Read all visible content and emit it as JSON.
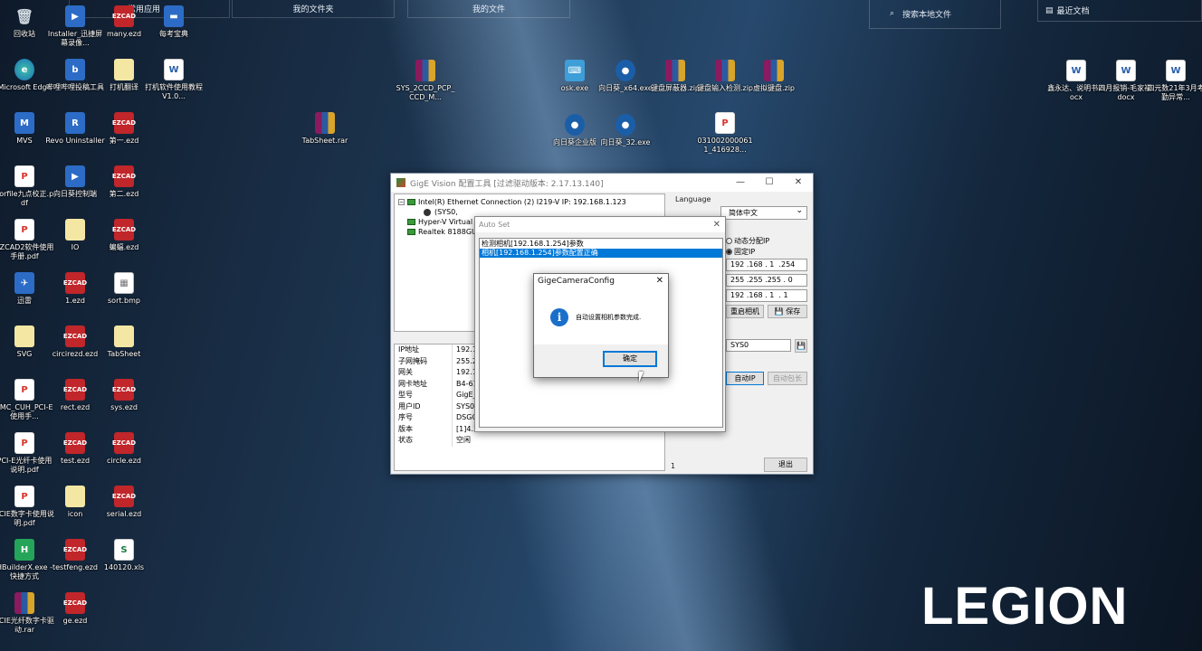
{
  "topbar": {
    "cells": [
      {
        "label": "常用应用"
      },
      {
        "label": "我的文件夹"
      },
      {
        "label": "我的文件"
      }
    ],
    "search_placeholder": "搜索本地文件",
    "recent_label": "最近文档"
  },
  "desktop": {
    "col1": [
      {
        "label": "回收站",
        "glyph": "🗑",
        "icon": "recycle-bin-icon",
        "style": "g-bin"
      },
      {
        "label": "Microsoft Edge",
        "glyph": "e",
        "icon": "edge-icon",
        "style": "g-edge"
      },
      {
        "label": "MVS",
        "glyph": "M",
        "icon": "mvs-icon",
        "style": "g-app"
      },
      {
        "label": "corfile九点校正.pdf",
        "glyph": "P",
        "icon": "pdf-icon",
        "style": "g-pdf"
      },
      {
        "label": "EZCAD2软件使用手册.pdf",
        "glyph": "P",
        "icon": "pdf-icon",
        "style": "g-pdf"
      },
      {
        "label": "迅雷",
        "glyph": "✈",
        "icon": "xunlei-icon",
        "style": "g-app"
      },
      {
        "label": "SVG",
        "glyph": "",
        "icon": "file-icon",
        "style": "g-file"
      },
      {
        "label": "LMC_CUH_PCI-E使用手...",
        "glyph": "P",
        "icon": "pdf-icon",
        "style": "g-pdf"
      },
      {
        "label": "PCI-E光纤卡使用说明.pdf",
        "glyph": "P",
        "icon": "pdf-icon",
        "style": "g-pdf"
      },
      {
        "label": "PCIE数字卡使用说明.pdf",
        "glyph": "P",
        "icon": "pdf-icon",
        "style": "g-pdf"
      },
      {
        "label": "HBuilderX.exe - 快捷方式",
        "glyph": "H",
        "icon": "hbuilder-icon",
        "style": "g-green"
      },
      {
        "label": "PCIE光纤数字卡驱动.rar",
        "glyph": "",
        "icon": "rar-icon",
        "style": "g-rar"
      }
    ],
    "col2": [
      {
        "label": "Installer_迅捷屏幕录像...",
        "glyph": "▶",
        "icon": "video-recorder-icon",
        "style": "g-app"
      },
      {
        "label": "哔哩哔哩投稿工具",
        "glyph": "b",
        "icon": "bilibili-icon",
        "style": "g-app"
      },
      {
        "label": "Revo Uninstaller",
        "glyph": "R",
        "icon": "uninstaller-icon",
        "style": "g-app"
      },
      {
        "label": "向日葵控制端",
        "glyph": "▶",
        "icon": "sunlogin-icon",
        "style": "g-app"
      },
      {
        "label": "IO",
        "glyph": "",
        "icon": "file-icon",
        "style": "g-file"
      },
      {
        "label": "1.ezd",
        "glyph": "EZCAD",
        "icon": "ezd-icon",
        "style": "g-ezd"
      },
      {
        "label": "circirezd.ezd",
        "glyph": "EZCAD",
        "icon": "ezd-icon",
        "style": "g-ezd"
      },
      {
        "label": "rect.ezd",
        "glyph": "EZCAD",
        "icon": "ezd-icon",
        "style": "g-ezd"
      },
      {
        "label": "test.ezd",
        "glyph": "EZCAD",
        "icon": "ezd-icon",
        "style": "g-ezd"
      },
      {
        "label": "icon",
        "glyph": "",
        "icon": "file-icon",
        "style": "g-file"
      },
      {
        "label": "testfeng.ezd",
        "glyph": "EZCAD",
        "icon": "ezd-icon",
        "style": "g-ezd"
      },
      {
        "label": "ge.ezd",
        "glyph": "EZCAD",
        "icon": "ezd-icon",
        "style": "g-ezd"
      }
    ],
    "col3": [
      {
        "label": "many.ezd",
        "glyph": "EZCAD",
        "icon": "ezd-icon",
        "style": "g-ezd"
      },
      {
        "label": "打机翻译",
        "glyph": "",
        "icon": "file-icon",
        "style": "g-file"
      },
      {
        "label": "第一.ezd",
        "glyph": "EZCAD",
        "icon": "ezd-icon",
        "style": "g-ezd"
      },
      {
        "label": "第二.ezd",
        "glyph": "EZCAD",
        "icon": "ezd-icon",
        "style": "g-ezd"
      },
      {
        "label": "蝙蝠.ezd",
        "glyph": "EZCAD",
        "icon": "ezd-icon",
        "style": "g-ezd"
      },
      {
        "label": "sort.bmp",
        "glyph": "▦",
        "icon": "bmp-icon",
        "style": "g-bmp"
      },
      {
        "label": "TabSheet",
        "glyph": "",
        "icon": "file-icon",
        "style": "g-file"
      },
      {
        "label": "sys.ezd",
        "glyph": "EZCAD",
        "icon": "ezd-icon",
        "style": "g-ezd"
      },
      {
        "label": "circle.ezd",
        "glyph": "EZCAD",
        "icon": "ezd-icon",
        "style": "g-ezd"
      },
      {
        "label": "serial.ezd",
        "glyph": "EZCAD",
        "icon": "ezd-icon",
        "style": "g-ezd"
      },
      {
        "label": "140120.xls",
        "glyph": "S",
        "icon": "xls-icon",
        "style": "g-xls"
      }
    ],
    "col4": [
      {
        "label": "每考宝典",
        "glyph": "▬",
        "icon": "app-icon",
        "style": "g-app"
      },
      {
        "label": "打机软件使用教程V1.0...",
        "glyph": "W",
        "icon": "doc-icon",
        "style": "g-doc"
      }
    ],
    "loose": [
      {
        "label": "TabSheet.rar",
        "glyph": "",
        "icon": "rar-icon",
        "style": "g-rar"
      },
      {
        "label": "SYS_2CCD_PCP_CCD_M...",
        "glyph": "",
        "icon": "rar-icon",
        "style": "g-rar"
      },
      {
        "label": "osk.exe",
        "glyph": "⌨",
        "icon": "keyboard-icon",
        "style": "g-kbd"
      },
      {
        "label": "向日葵_x64.exe",
        "glyph": "●",
        "icon": "sunlogin-icon",
        "style": "g-exe"
      },
      {
        "label": "键盘屏蔽器.zip",
        "glyph": "",
        "icon": "rar-icon",
        "style": "g-rar"
      },
      {
        "label": "键盘输入检测.zip",
        "glyph": "",
        "icon": "rar-icon",
        "style": "g-rar"
      },
      {
        "label": "虚拟键盘.zip",
        "glyph": "",
        "icon": "rar-icon",
        "style": "g-rar"
      },
      {
        "label": "向日葵企业版",
        "glyph": "●",
        "icon": "sunlogin-icon",
        "style": "g-exe"
      },
      {
        "label": "向日葵_32.exe",
        "glyph": "●",
        "icon": "sunlogin-icon",
        "style": "g-exe"
      },
      {
        "label": "0310020000611_416928...",
        "glyph": "P",
        "icon": "pdf-icon",
        "style": "g-pdf"
      },
      {
        "label": "鑫永达、说明书.docx",
        "glyph": "W",
        "icon": "doc-icon",
        "style": "g-doc"
      },
      {
        "label": "四月报销-毛家福.docx",
        "glyph": "W",
        "icon": "doc-icon",
        "style": "g-doc"
      },
      {
        "label": "四元数21年3月考勤异常...",
        "glyph": "W",
        "icon": "doc-icon",
        "style": "g-doc"
      }
    ]
  },
  "main_window": {
    "title": "GigE Vision 配置工具 [过滤驱动版本: 2.17.13.140]",
    "tree": [
      {
        "label": "Intel(R) Ethernet Connection (2) I219-V  IP: 192.168.1.123"
      },
      {
        "label": "(SYS0,"
      },
      {
        "label": "Hyper-V Virtual"
      },
      {
        "label": "Realtek 8188GU"
      }
    ],
    "props": [
      {
        "k": "IP地址",
        "v": "192.1("
      },
      {
        "k": "子网掩码",
        "v": "255.2!"
      },
      {
        "k": "网关",
        "v": "192.1("
      },
      {
        "k": "网卡地址",
        "v": "B4-61-"
      },
      {
        "k": "型号",
        "v": "GigE_"
      },
      {
        "k": "用户ID",
        "v": "SYS0"
      },
      {
        "k": "序号",
        "v": "DSGQ"
      },
      {
        "k": "版本",
        "v": "[1]4.3"
      },
      {
        "k": "状态",
        "v": "空闲"
      }
    ],
    "language_label": "Language",
    "language_value": "简体中文",
    "dhcp_label": "动态分配IP",
    "static_label": "固定IP",
    "ip_value": "192 .168 . 1  .254",
    "mask_value": "255 .255 .255 . 0",
    "gateway_value": "192 .168 . 1  . 1",
    "restart_label": "重启相机",
    "save_label": "保存",
    "userid_value": "SYS0",
    "auto_ip_label": "自动IP",
    "auto_pkt_label": "自动包长",
    "count_value": "1",
    "exit_label": "退出"
  },
  "autoset": {
    "title": "Auto Set",
    "items": [
      {
        "label": "检测相机[192.168.1.254]参数"
      },
      {
        "label": "相机[192.168.1.254]参数配置正确"
      }
    ]
  },
  "msgbox": {
    "title": "GigeCameraConfig",
    "message": "自动设置相机参数完成.",
    "ok_label": "确定"
  },
  "brand": {
    "logo": "LEGION"
  }
}
